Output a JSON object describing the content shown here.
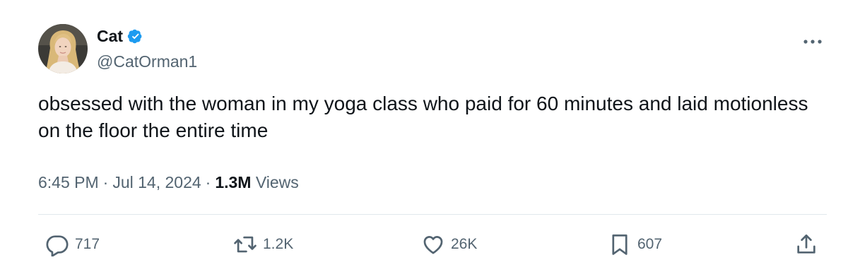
{
  "author": {
    "display_name": "Cat",
    "handle": "@CatOrman1",
    "verified": true
  },
  "tweet": {
    "text": "obsessed with the woman in my yoga class who paid for 60 minutes and laid motionless on the floor the entire time",
    "time": "6:45 PM",
    "date": "Jul 14, 2024",
    "views_count": "1.3M",
    "views_label": "Views"
  },
  "actions": {
    "replies": "717",
    "reposts": "1.2K",
    "likes": "26K",
    "bookmarks": "607"
  },
  "icons": {
    "verified": "verified-badge-icon",
    "more": "more-icon",
    "reply": "reply-icon",
    "repost": "repost-icon",
    "like": "heart-icon",
    "bookmark": "bookmark-icon",
    "share": "share-icon"
  },
  "colors": {
    "text_primary": "#0f1419",
    "text_secondary": "#536471",
    "verified_blue": "#1d9bf0",
    "divider": "#e1e8ed"
  }
}
